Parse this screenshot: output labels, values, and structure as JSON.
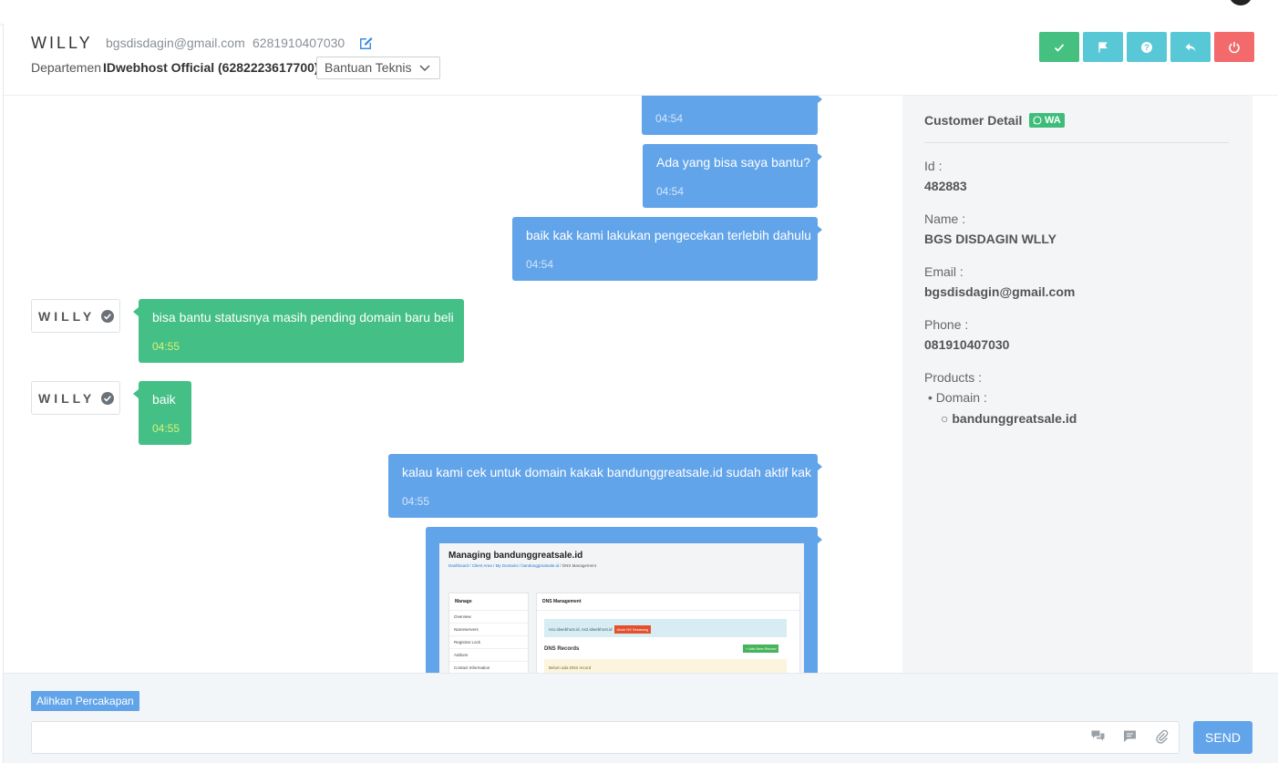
{
  "header": {
    "name": "WILLY",
    "email": "bgsdisdagin@gmail.com",
    "phone": "6281910407030",
    "department_label": "Departemen",
    "department_name": "IDwebhost Official (6282223617700)",
    "topic_selected": "Bantuan Teknis"
  },
  "actions": [
    {
      "icon": "check-icon",
      "color": "#45c080"
    },
    {
      "icon": "flag-icon",
      "color": "#58c7d6"
    },
    {
      "icon": "help-icon",
      "color": "#58c7d6"
    },
    {
      "icon": "reply-icon",
      "color": "#58c7d6"
    },
    {
      "icon": "power-icon",
      "color": "#f26a6c"
    }
  ],
  "messages": [
    {
      "side": "out",
      "text": "",
      "time": "04:54"
    },
    {
      "side": "out",
      "text": "Ada yang bisa saya bantu?",
      "time": "04:54"
    },
    {
      "side": "out",
      "text": "baik kak kami lakukan pengecekan terlebih dahulu",
      "time": "04:54"
    },
    {
      "side": "in",
      "sender": "WILLY",
      "text": "bisa bantu statusnya masih pending domain baru beli",
      "time": "04:55"
    },
    {
      "side": "in",
      "sender": "WILLY",
      "text": "baik",
      "time": "04:55"
    },
    {
      "side": "out",
      "text": "kalau kami cek untuk domain kakak bandunggreatsale.id sudah aktif kak",
      "time": "04:55"
    }
  ],
  "image_message": {
    "title": "Managing bandunggreatsale.id",
    "crumbs": [
      "Dashboard",
      "Client Area",
      "My Domains",
      "bandunggreatsale.id",
      "DNS Management"
    ],
    "side_head": "Manage",
    "side_items": [
      "Overview",
      "Nameservers",
      "Registrar Lock",
      "Addons",
      "Contact Information"
    ],
    "main_head": "DNS Management",
    "ns_text": "ns1.idwebhost.id, ns2.idwebhost.id",
    "ns_button": "Ubah NS Sekarang",
    "dns_records": "DNS Records",
    "add_record": "+ Add New Record",
    "empty_text": "Belum ada DNS record"
  },
  "customer": {
    "title": "Customer Detail",
    "badge": "WA",
    "id_label": "Id :",
    "id_value": "482883",
    "name_label": "Name :",
    "name_value": "BGS DISDAGIN WLLY",
    "email_label": "Email :",
    "email_value": "bgsdisdagin@gmail.com",
    "phone_label": "Phone :",
    "phone_value": "081910407030",
    "products_label": "Products :",
    "product_type": "Domain :",
    "product_name": "bandunggreatsale.id"
  },
  "footer": {
    "redirect_label": "Alihkan Percakapan",
    "input_value": "",
    "send_label": "SEND"
  },
  "colors": {
    "outgoing": "#62a4ea",
    "incoming": "#44bf86",
    "timestamp_incoming": "#d7f27a"
  }
}
